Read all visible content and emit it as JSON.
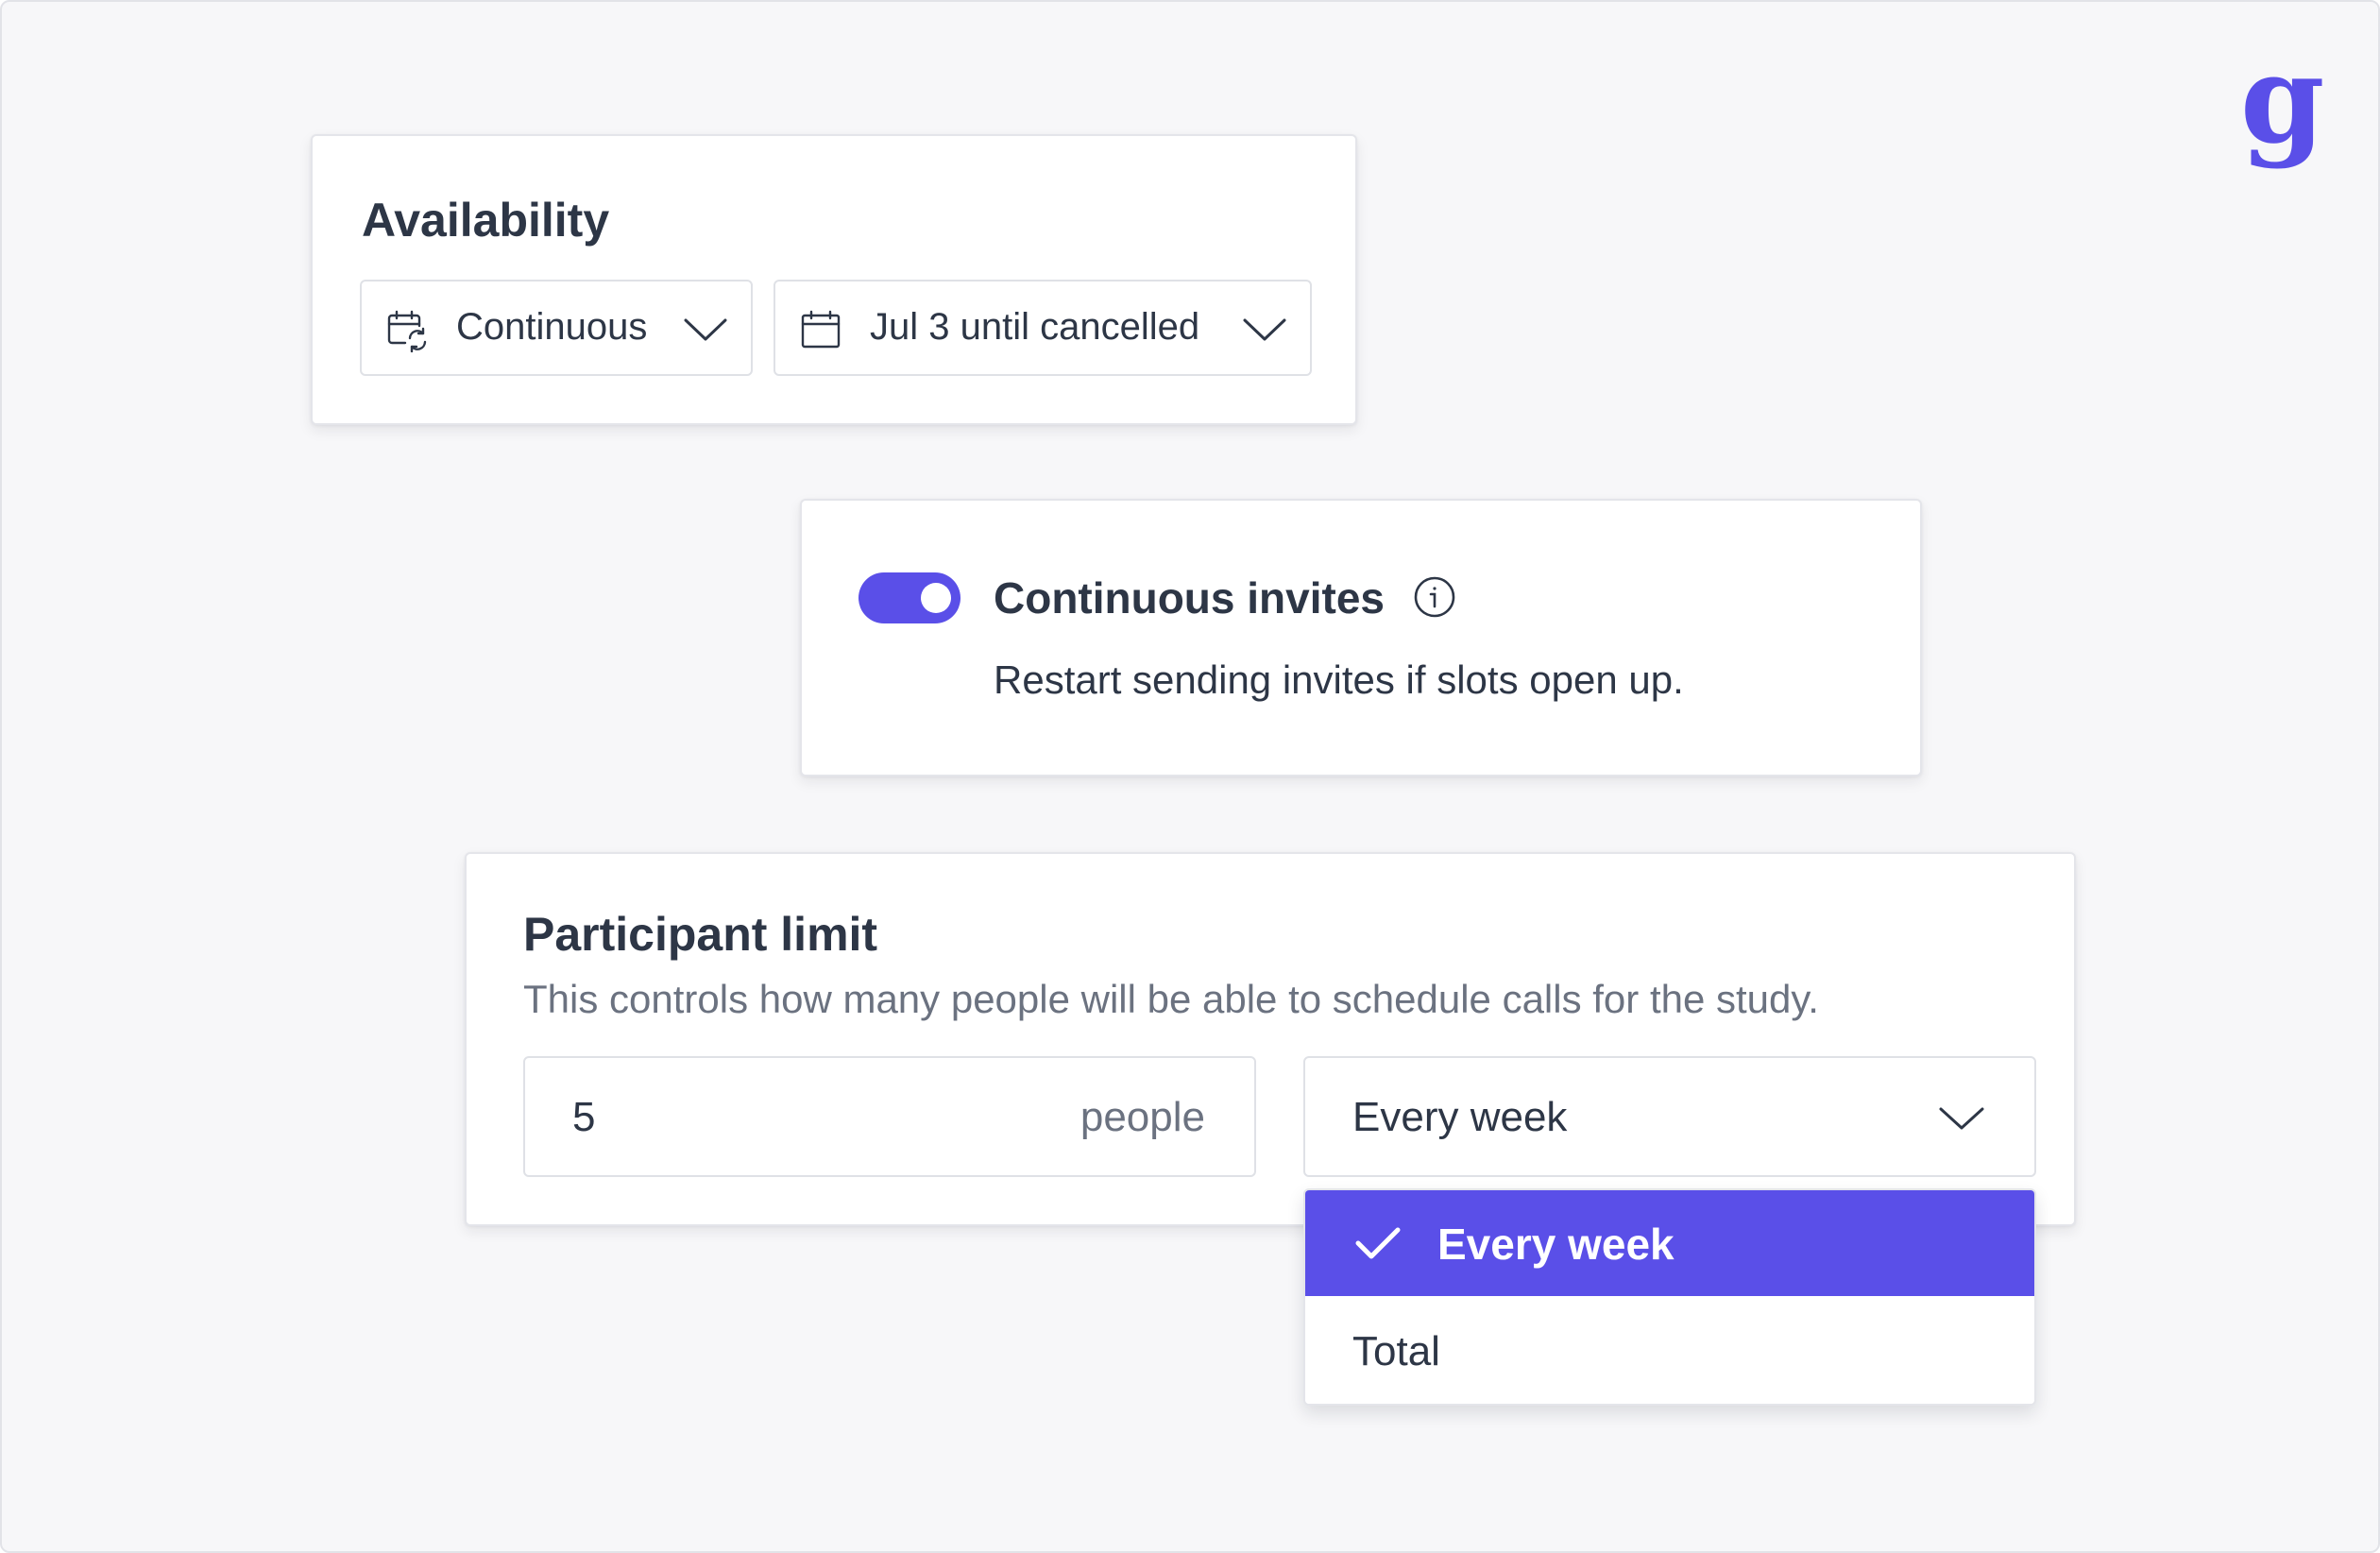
{
  "brand": {
    "logo_text": "g",
    "accent_color": "#5a4fe8"
  },
  "availability": {
    "title": "Availability",
    "mode_select": {
      "icon": "calendar-refresh-icon",
      "value": "Continuous"
    },
    "date_select": {
      "icon": "calendar-icon",
      "value": "Jul 3 until cancelled"
    }
  },
  "continuous_invites": {
    "toggle_on": true,
    "title": "Continuous invites",
    "info_icon": "info-icon",
    "description": "Restart sending invites if slots open up."
  },
  "participant_limit": {
    "title": "Participant limit",
    "description": "This controls how many people will be able to schedule calls for the study.",
    "count_value": "5",
    "count_suffix": "people",
    "frequency_value": "Every week",
    "frequency_options": [
      {
        "label": "Every week",
        "selected": true
      },
      {
        "label": "Total",
        "selected": false
      }
    ]
  }
}
